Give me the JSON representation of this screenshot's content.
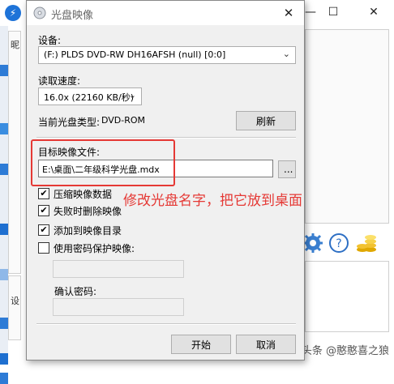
{
  "dialog": {
    "title": "光盘映像",
    "device_label": "设备:",
    "device_value": "(F:) PLDS DVD-RW DH16AFSH (null) [0:0]",
    "speed_label": "读取速度:",
    "speed_value": "16.0x (22160 KB/秒)",
    "disc_type_label": "当前光盘类型:",
    "disc_type_value": "DVD-ROM",
    "refresh_label": "刷新",
    "target_label": "目标映像文件:",
    "target_value": "E:\\桌面\\二年级科学光盘.mdx",
    "browse_label": "...",
    "checkboxes": [
      {
        "label": "压缩映像数据",
        "checked": "✔"
      },
      {
        "label": "失败时删除映像",
        "checked": "✔"
      },
      {
        "label": "添加到映像目录",
        "checked": "✔"
      },
      {
        "label": "使用密码保护映像:",
        "checked": ""
      }
    ],
    "confirm_password_label": "确认密码:",
    "start_label": "开始",
    "cancel_label": "取消"
  },
  "annotation": "修改光盘名字，把它放到桌面",
  "background": {
    "left_fragments": [
      "昵",
      "设"
    ],
    "watermark": "头条 @憨憨喜之狼"
  },
  "colors": {
    "accent_red": "#e53935",
    "app_blue": "#1e73d8"
  }
}
